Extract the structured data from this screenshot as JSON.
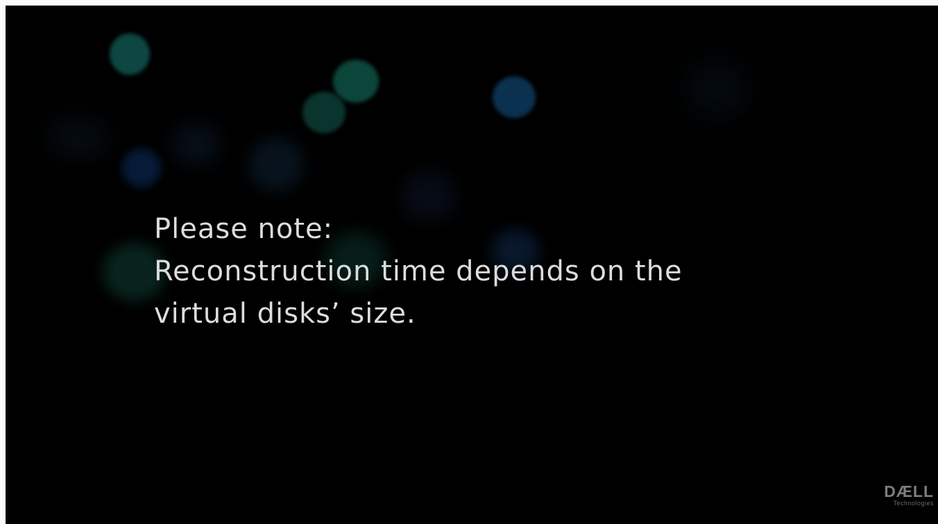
{
  "slide": {
    "note_lines": [
      "Please note:",
      "Reconstruction time depends on the",
      "virtual disks’ size."
    ]
  },
  "logo": {
    "wordmark": "DÆLL",
    "subtitle": "Technologies"
  },
  "colors": {
    "background": "#000000",
    "text": "#dcdcdc",
    "logo": "#7d7d7d"
  }
}
